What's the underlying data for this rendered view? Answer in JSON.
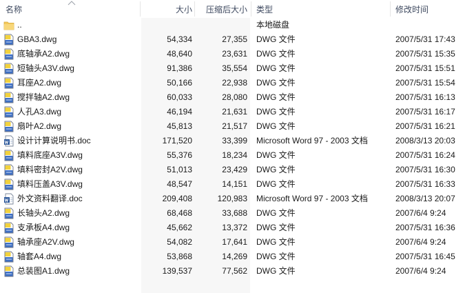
{
  "columns": {
    "name": "名称",
    "size": "大小",
    "compressed": "压缩后大小",
    "type": "类型",
    "modified": "修改时间"
  },
  "files": [
    {
      "name": "..",
      "size": "",
      "compressed": "",
      "type": "本地磁盘",
      "modified": "",
      "icon": "folder-icon"
    },
    {
      "name": "GBA3.dwg",
      "size": "54,334",
      "compressed": "27,355",
      "type": "DWG 文件",
      "modified": "2007/5/31 17:43",
      "icon": "dwg-file-icon"
    },
    {
      "name": "底轴承A2.dwg",
      "size": "48,640",
      "compressed": "23,631",
      "type": "DWG 文件",
      "modified": "2007/5/31 15:35",
      "icon": "dwg-file-icon"
    },
    {
      "name": "短轴头A3V.dwg",
      "size": "91,386",
      "compressed": "35,554",
      "type": "DWG 文件",
      "modified": "2007/5/31 15:51",
      "icon": "dwg-file-icon"
    },
    {
      "name": "耳座A2.dwg",
      "size": "50,166",
      "compressed": "22,938",
      "type": "DWG 文件",
      "modified": "2007/5/31 15:54",
      "icon": "dwg-file-icon"
    },
    {
      "name": "搅拌轴A2.dwg",
      "size": "60,033",
      "compressed": "28,080",
      "type": "DWG 文件",
      "modified": "2007/5/31 16:13",
      "icon": "dwg-file-icon"
    },
    {
      "name": "人孔A3.dwg",
      "size": "46,194",
      "compressed": "21,631",
      "type": "DWG 文件",
      "modified": "2007/5/31 16:17",
      "icon": "dwg-file-icon"
    },
    {
      "name": "扇叶A2.dwg",
      "size": "45,813",
      "compressed": "21,517",
      "type": "DWG 文件",
      "modified": "2007/5/31 16:21",
      "icon": "dwg-file-icon"
    },
    {
      "name": "设计计算说明书.doc",
      "size": "171,520",
      "compressed": "33,399",
      "type": "Microsoft Word 97 - 2003 文档",
      "modified": "2008/3/13 20:03",
      "icon": "word-doc-icon"
    },
    {
      "name": "填料底座A3V.dwg",
      "size": "55,376",
      "compressed": "18,234",
      "type": "DWG 文件",
      "modified": "2007/5/31 16:24",
      "icon": "dwg-file-icon"
    },
    {
      "name": "填料密封A2V.dwg",
      "size": "51,013",
      "compressed": "23,429",
      "type": "DWG 文件",
      "modified": "2007/5/31 16:30",
      "icon": "dwg-file-icon"
    },
    {
      "name": "填料压盖A3V.dwg",
      "size": "48,547",
      "compressed": "14,151",
      "type": "DWG 文件",
      "modified": "2007/5/31 16:33",
      "icon": "dwg-file-icon"
    },
    {
      "name": "外文资料翻译.doc",
      "size": "209,408",
      "compressed": "120,983",
      "type": "Microsoft Word 97 - 2003 文档",
      "modified": "2008/3/13 20:07",
      "icon": "word-doc-icon"
    },
    {
      "name": "长轴头A2.dwg",
      "size": "68,468",
      "compressed": "33,688",
      "type": "DWG 文件",
      "modified": "2007/6/4 9:24",
      "icon": "dwg-file-icon"
    },
    {
      "name": "支承板A4.dwg",
      "size": "45,662",
      "compressed": "13,372",
      "type": "DWG 文件",
      "modified": "2007/5/31 16:36",
      "icon": "dwg-file-icon"
    },
    {
      "name": "轴承座A2V.dwg",
      "size": "54,082",
      "compressed": "17,641",
      "type": "DWG 文件",
      "modified": "2007/6/4 9:24",
      "icon": "dwg-file-icon"
    },
    {
      "name": "轴套A4.dwg",
      "size": "53,868",
      "compressed": "14,269",
      "type": "DWG 文件",
      "modified": "2007/5/31 16:45",
      "icon": "dwg-file-icon"
    },
    {
      "name": "总装图A1.dwg",
      "size": "139,537",
      "compressed": "77,562",
      "type": "DWG 文件",
      "modified": "2007/6/4 9:24",
      "icon": "dwg-file-icon"
    }
  ],
  "colors": {
    "header_text": "#3f4a60",
    "size_column_shade": "#f7f7f7",
    "dwg_icon_yellow": "#f2d23c",
    "doc_icon_blue": "#2b579a",
    "folder_yellow": "#f3c85a"
  }
}
